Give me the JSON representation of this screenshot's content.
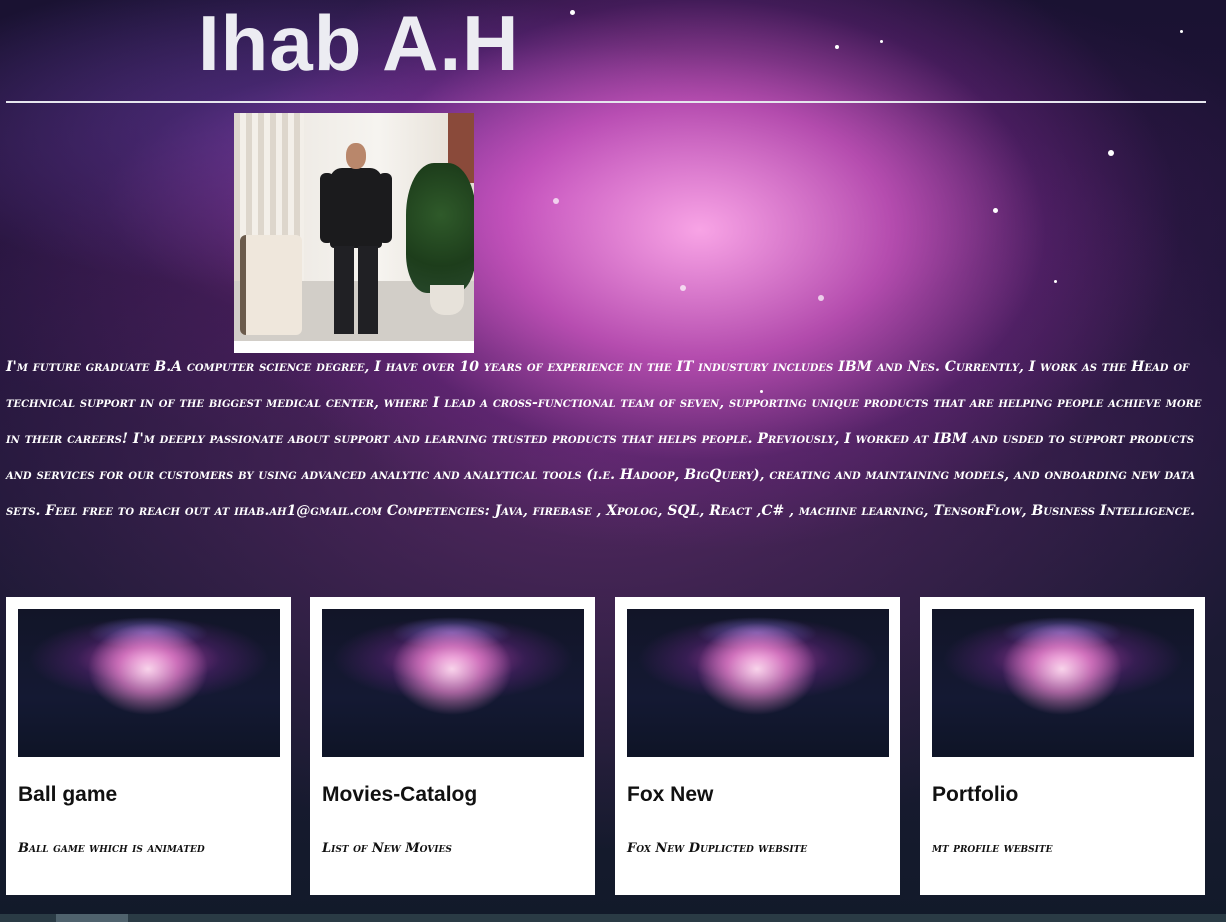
{
  "header": {
    "title": "Ihab A.H"
  },
  "profile": {
    "photo_alt": "profile photo",
    "bio": "I'm future graduate B.A computer science degree, I have over 10 years of experience in the IT industury includes IBM and Nes. Currently, I work as the Head of technical support in of the biggest medical center, where I lead a cross-functional team of seven, supporting unique products that are helping people achieve more in their careers! I'm deeply passionate about support and learning trusted products that helps people. Previously, I worked at IBM and usded to support products and services for our customers by using advanced analytic and analytical tools (i.e. Hadoop, BigQuery), creating and maintaining models, and onboarding new data sets. Feel free to reach out at ihab.ah1@gmail.com Competencies: Java, firebase , Xpolog, SQL, React ,C# , machine learning, TensorFlow, Business Intelligence."
  },
  "projects": [
    {
      "title": "Ball game",
      "description": "Ball game which is animated"
    },
    {
      "title": "Movies-Catalog",
      "description": "List of New Movies"
    },
    {
      "title": "Fox New",
      "description": "Fox New Duplicted website"
    },
    {
      "title": "Portfolio",
      "description": "mt profile website"
    }
  ],
  "colors": {
    "card_background": "#ffffff",
    "title_text": "#ececf2",
    "bio_text": "#ffffff",
    "scrollbar_track": "#2a3b45",
    "scrollbar_thumb": "#4f626d"
  }
}
